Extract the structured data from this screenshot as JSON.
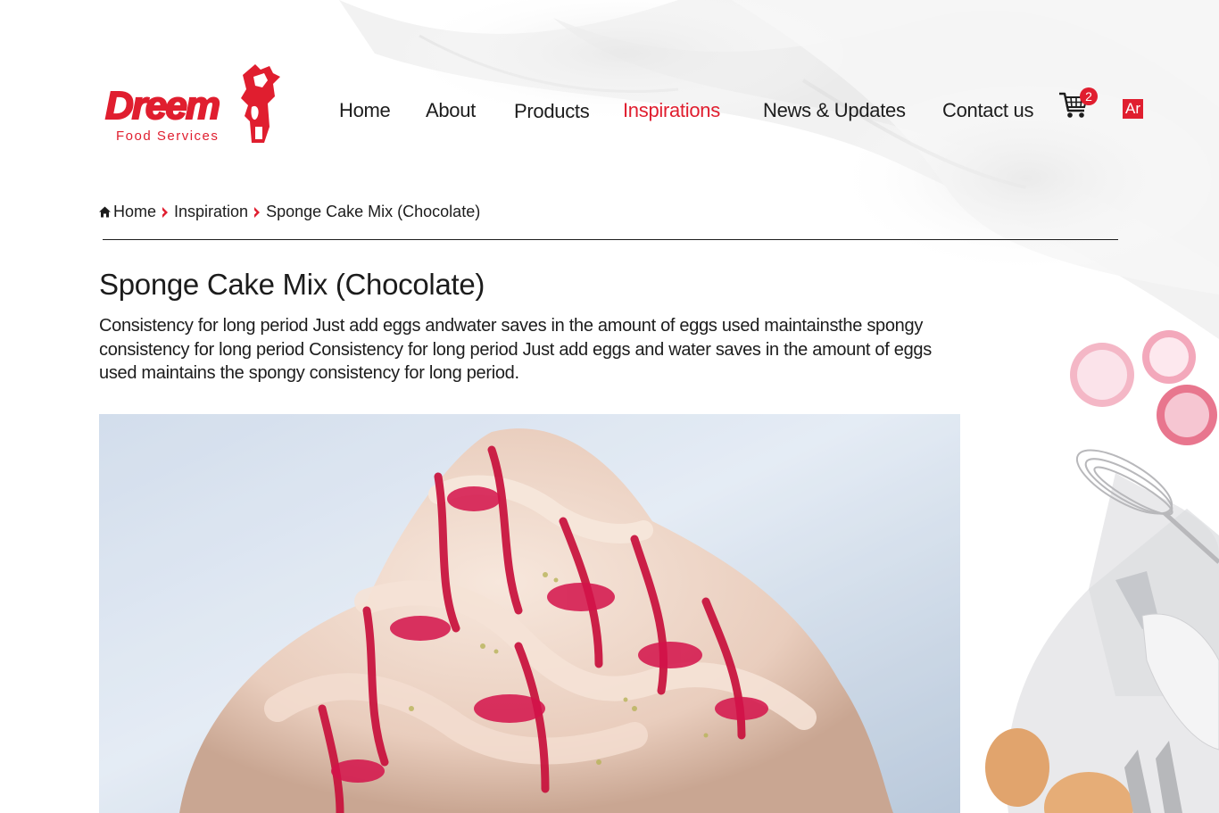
{
  "brand": {
    "name": "Dreem",
    "tagline": "Food Services",
    "accent_color": "#e01e2f"
  },
  "nav": {
    "items": [
      {
        "label": "Home"
      },
      {
        "label": "About"
      },
      {
        "label": "Products"
      },
      {
        "label": "Inspirations",
        "active": true
      },
      {
        "label": "News & Updates"
      },
      {
        "label": "Contact us"
      }
    ],
    "cart_count": "2",
    "cart_icon": "shopping-cart-icon",
    "language_label": "Ar"
  },
  "breadcrumb": {
    "home_icon": "home-icon",
    "separator_icon": "caret-right-icon",
    "items": [
      "Home",
      "Inspiration",
      "Sponge Cake Mix (Chocolate)"
    ]
  },
  "article": {
    "title": "Sponge Cake Mix (Chocolate)",
    "description": "Consistency for long period Just add eggs andwater saves in the amount of eggs used maintainsthe spongy consistency for long period Consistency for long period Just add eggs and water saves in the amount of eggs used maintains the spongy consistency for long period.",
    "image_subject": "meringue dessert with raspberry sauce"
  }
}
